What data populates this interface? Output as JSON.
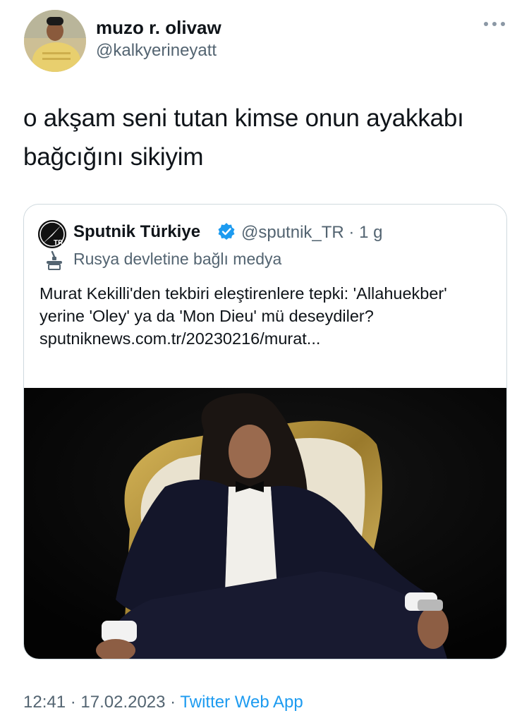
{
  "author": {
    "display_name": "muzo r. olivaw",
    "handle": "@kalkyerineyatt"
  },
  "more_icon": "more-horizontal-icon",
  "tweet": {
    "text": "o akşam seni tutan kimse onun ayakkabı bağcığını sikiyim"
  },
  "quoted_tweet": {
    "display_name": "Sputnik Türkiye",
    "verified_icon": "verified-badge-icon",
    "handle_time": "@sputnik_TR · 1 g",
    "avatar_text": "TR",
    "state_media_icon": "state-media-podium-icon",
    "state_media_label": "Rusya devletine bağlı medya",
    "text": "Murat Kekilli'den tekbiri eleştirenlere tepki: 'Allahuekber' yerine 'Oley' ya da 'Mon Dieu' mü deseydiler?",
    "link": "sputniknews.com.tr/20230216/murat..."
  },
  "timestamp": {
    "time_date": "12:41 · 17.02.2023 · ",
    "source": "Twitter Web App"
  },
  "colors": {
    "accent": "#1d9bf0",
    "secondary_text": "#536471",
    "border": "#cfd9de"
  }
}
